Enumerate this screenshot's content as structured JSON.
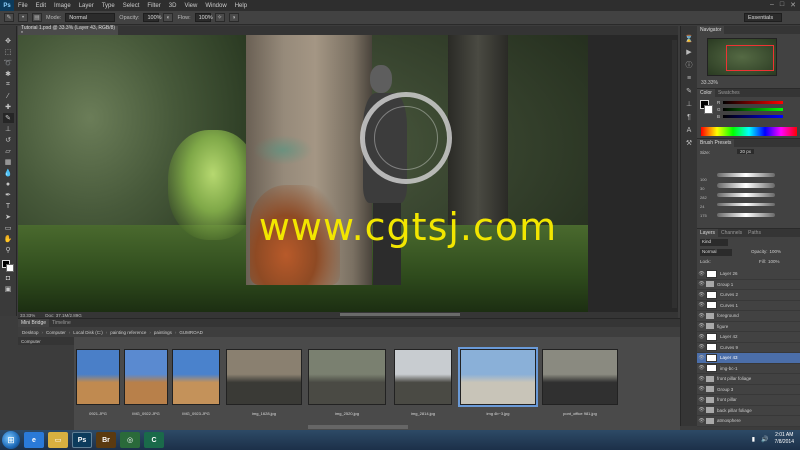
{
  "app": {
    "logo": "Ps",
    "menu": [
      "File",
      "Edit",
      "Image",
      "Layer",
      "Type",
      "Select",
      "Filter",
      "3D",
      "View",
      "Window",
      "Help"
    ],
    "window_controls": [
      "–",
      "□",
      "✕"
    ]
  },
  "options": {
    "mode_label": "Mode:",
    "mode_value": "Normal",
    "opacity_label": "Opacity:",
    "opacity_value": "100%",
    "flow_label": "Flow:",
    "flow_value": "100%",
    "workspace": "Essentials"
  },
  "document": {
    "tab_title": "Tutorial 1.psd @ 33.3% (Layer 43, RGB/8) *",
    "watermark": "www.cgtsj.com",
    "zoom": "33.33%",
    "doc_info": "Doc: 37.1M/2.89G"
  },
  "navigator": {
    "tabs": [
      "Navigator"
    ],
    "zoom": "33.33%"
  },
  "color_panel": {
    "tabs": [
      "Color",
      "Swatches"
    ],
    "channels": [
      "R",
      "G",
      "B"
    ]
  },
  "brush_presets": {
    "tabs": [
      "Brush Presets"
    ],
    "size_label": "Size:",
    "size_value": "20 px",
    "sizes": [
      "100",
      "30",
      "282",
      "24",
      "175"
    ]
  },
  "layers_panel": {
    "tabs": [
      "Layers",
      "Channels",
      "Paths"
    ],
    "filter": "Kind",
    "blend": "Normal",
    "opacity_label": "Opacity:",
    "opacity_value": "100%",
    "fill_label": "Fill:",
    "fill_value": "100%",
    "lock_label": "Lock:",
    "layers": [
      {
        "name": "Layer 26",
        "type": "layer",
        "selected": false
      },
      {
        "name": "Group 1",
        "type": "folder",
        "selected": false
      },
      {
        "name": "Curves 2",
        "type": "layer",
        "selected": false
      },
      {
        "name": "Curves 1",
        "type": "layer",
        "selected": false
      },
      {
        "name": "foreground",
        "type": "folder",
        "selected": false
      },
      {
        "name": "figure",
        "type": "folder",
        "selected": false
      },
      {
        "name": "Layer 42",
        "type": "layer",
        "selected": false
      },
      {
        "name": "Curves 9",
        "type": "layer",
        "selected": false
      },
      {
        "name": "Layer 43",
        "type": "layer",
        "selected": true
      },
      {
        "name": "img-bc-1",
        "type": "layer",
        "selected": false
      },
      {
        "name": "front pillar foliage",
        "type": "folder",
        "selected": false
      },
      {
        "name": "Group 3",
        "type": "folder",
        "selected": false
      },
      {
        "name": "front pillar",
        "type": "folder",
        "selected": false
      },
      {
        "name": "back pillar foliage",
        "type": "folder",
        "selected": false
      },
      {
        "name": "atmosphere",
        "type": "folder",
        "selected": false
      }
    ]
  },
  "bridge": {
    "tabs": [
      "Mini Bridge",
      "Timeline"
    ],
    "breadcrumb": [
      "Desktop",
      "Computer",
      "Local Disk (C:)",
      "painting reference",
      "paintings",
      "GUMROAD"
    ],
    "left_header": "Computer",
    "thumbnails": [
      {
        "label": "0921.JPG",
        "colors": [
          "#4a7fc8",
          "#c08a50"
        ],
        "selected": false
      },
      {
        "label": "IMG_0922.JPG",
        "colors": [
          "#5a8ad0",
          "#b8804a"
        ],
        "selected": false
      },
      {
        "label": "IMG_0923.JPG",
        "colors": [
          "#4a82cc",
          "#c4925a"
        ],
        "selected": false
      },
      {
        "label": "img_1628.jpg",
        "colors": [
          "#8a8070",
          "#3a3a36"
        ],
        "selected": false
      },
      {
        "label": "img_2520.jpg",
        "colors": [
          "#7a8070",
          "#4a4a44"
        ],
        "selected": false
      },
      {
        "label": "img_2814.jpg",
        "colors": [
          "#c8ccd0",
          "#4a4a44"
        ],
        "selected": false
      },
      {
        "label": "img 4b~3.jpg",
        "colors": [
          "#8ab0d8",
          "#c8c4b8"
        ],
        "selected": true
      },
      {
        "label": "pont_office 981.jpg",
        "colors": [
          "#8a8a80",
          "#303030"
        ],
        "selected": false
      }
    ]
  },
  "taskbar": {
    "start": "⊞",
    "apps": [
      {
        "name": "ie",
        "label": "e",
        "color": "#2a7ad8"
      },
      {
        "name": "explorer",
        "label": "▭",
        "color": "#d8b040"
      },
      {
        "name": "photoshop",
        "label": "Ps",
        "color": "#0c3b5c"
      },
      {
        "name": "bridge",
        "label": "Br",
        "color": "#5a3a10"
      },
      {
        "name": "camtasia",
        "label": "◎",
        "color": "#2a6a3a"
      },
      {
        "name": "app-c",
        "label": "C",
        "color": "#1a6a4a"
      }
    ],
    "time": "2:01 AM",
    "date": "7/8/2014"
  },
  "colors": {
    "accent": "#4b6ea9",
    "watermark": "#f2e600",
    "panel_bg": "#424242"
  }
}
